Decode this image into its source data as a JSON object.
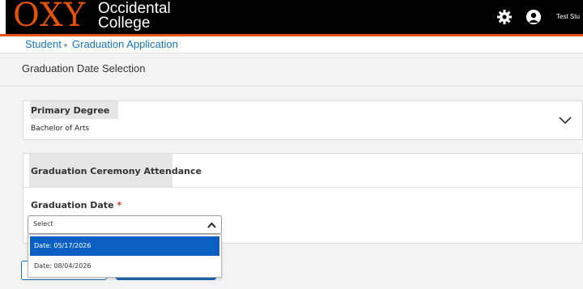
{
  "header": {
    "logo_main": "OXY",
    "logo_sub_line1": "Occidental",
    "logo_sub_line2": "College",
    "user_name": "Test Stu",
    "brand_color": "#e35205",
    "icons": [
      "gear-icon",
      "user-avatar-icon"
    ]
  },
  "breadcrumb": {
    "items": [
      "Student",
      "Graduation Application"
    ]
  },
  "page": {
    "title": "Graduation Date Selection"
  },
  "primary_degree": {
    "heading": "Primary Degree",
    "value": "Bachelor of Arts"
  },
  "ceremony": {
    "heading": "Graduation Ceremony Attendance",
    "field_label": "Graduation Date",
    "required_marker": "*",
    "select_value": "Select",
    "options": [
      "Date: 05/17/2026",
      "Date: 08/04/2026"
    ],
    "highlighted_option": "Date: 05/17/2026"
  }
}
